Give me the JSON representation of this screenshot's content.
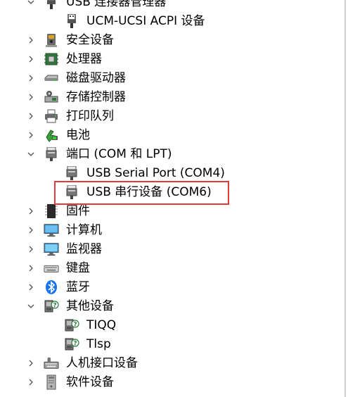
{
  "tree": {
    "nodes": [
      {
        "label": "USB 连接器管理器",
        "level": 0,
        "expanded": true,
        "icon": "usb-connector-icon"
      },
      {
        "label": "UCM-UCSI ACPI 设备",
        "level": 1,
        "icon": "usb-connector-icon"
      },
      {
        "label": "安全设备",
        "level": 0,
        "expanded": false,
        "icon": "security-key-icon"
      },
      {
        "label": "处理器",
        "level": 0,
        "expanded": false,
        "icon": "processor-chip-icon"
      },
      {
        "label": "磁盘驱动器",
        "level": 0,
        "expanded": false,
        "icon": "disk-drive-icon"
      },
      {
        "label": "存储控制器",
        "level": 0,
        "expanded": false,
        "icon": "storage-controller-icon"
      },
      {
        "label": "打印队列",
        "level": 0,
        "expanded": false,
        "icon": "printer-icon"
      },
      {
        "label": "电池",
        "level": 0,
        "expanded": false,
        "icon": "battery-icon"
      },
      {
        "label": "端口 (COM 和 LPT)",
        "level": 0,
        "expanded": true,
        "icon": "port-connector-icon"
      },
      {
        "label": "USB Serial Port (COM4)",
        "level": 1,
        "icon": "port-connector-icon"
      },
      {
        "label": "USB 串行设备 (COM6)",
        "level": 1,
        "icon": "port-connector-icon",
        "highlighted": true
      },
      {
        "label": "固件",
        "level": 0,
        "expanded": false,
        "icon": "firmware-chip-icon"
      },
      {
        "label": "计算机",
        "level": 0,
        "expanded": false,
        "icon": "computer-monitor-icon"
      },
      {
        "label": "监视器",
        "level": 0,
        "expanded": false,
        "icon": "monitor-icon"
      },
      {
        "label": "键盘",
        "level": 0,
        "expanded": false,
        "icon": "keyboard-icon"
      },
      {
        "label": "蓝牙",
        "level": 0,
        "expanded": false,
        "icon": "bluetooth-icon"
      },
      {
        "label": "其他设备",
        "level": 0,
        "expanded": true,
        "icon": "unknown-device-icon"
      },
      {
        "label": "TIQQ",
        "level": 1,
        "icon": "unknown-device-icon"
      },
      {
        "label": "Tlsp",
        "level": 1,
        "icon": "unknown-device-icon"
      },
      {
        "label": "人机接口设备",
        "level": 0,
        "expanded": false,
        "icon": "hid-keyboard-icon"
      },
      {
        "label": "软件设备",
        "level": 0,
        "expanded": false,
        "icon": "software-device-icon"
      }
    ]
  },
  "colors": {
    "highlight_border": "#e33a3a",
    "bluetooth": "#1a73e8",
    "monitor": "#3a9ad9"
  }
}
